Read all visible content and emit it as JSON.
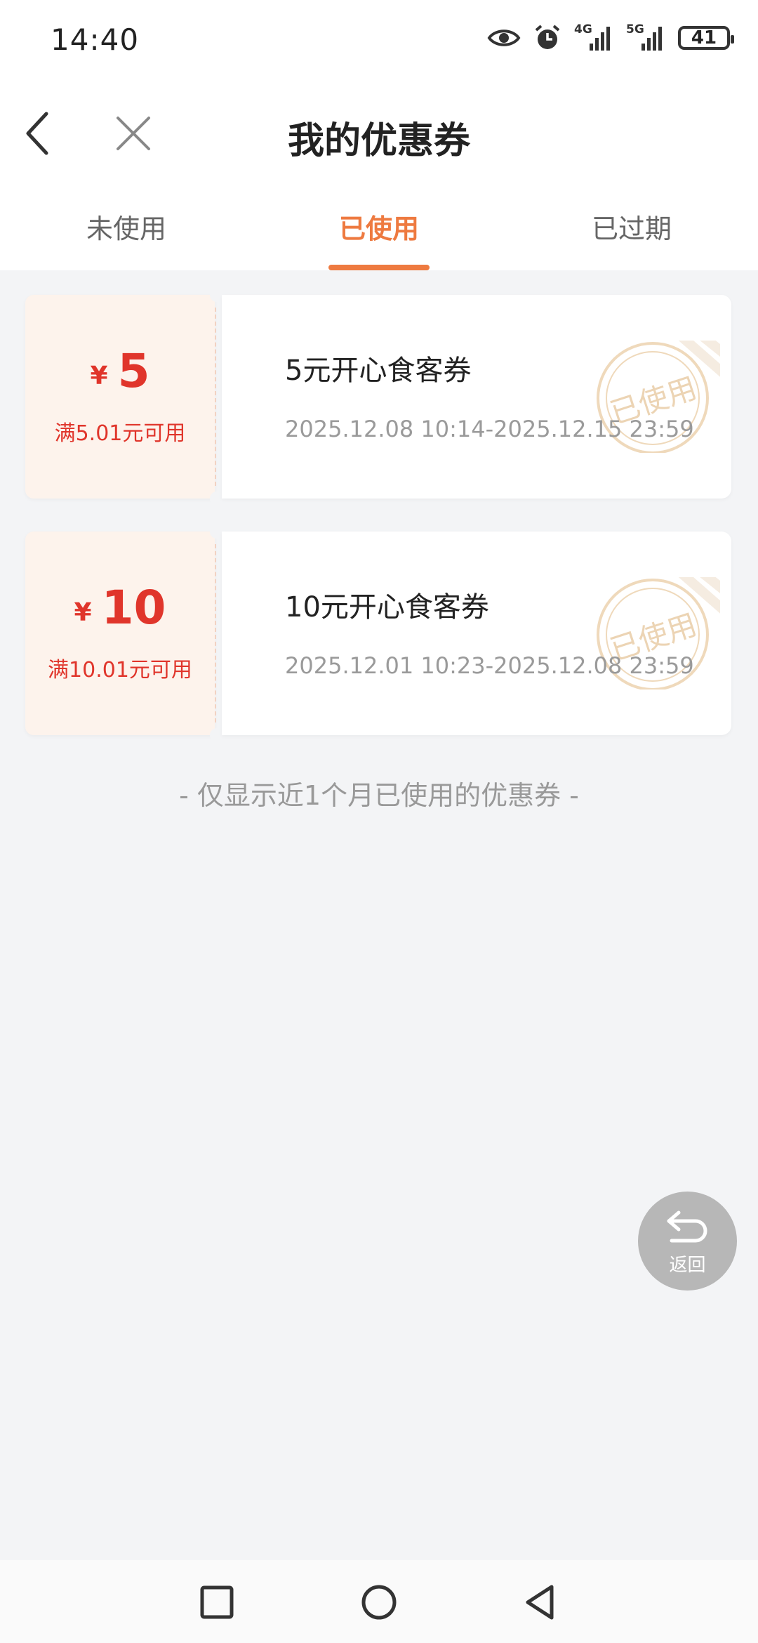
{
  "status_bar": {
    "time": "14:40",
    "signal_1": "4G",
    "signal_2": "5G",
    "battery": "41",
    "icons": [
      "eye-icon",
      "alarm-icon",
      "signal-icon",
      "signal-icon",
      "battery-icon"
    ]
  },
  "header": {
    "title": "我的优惠券",
    "back_icon": "chevron-left-icon",
    "close_icon": "close-icon"
  },
  "tabs": [
    {
      "label": "未使用",
      "active": false
    },
    {
      "label": "已使用",
      "active": true
    },
    {
      "label": "已过期",
      "active": false
    }
  ],
  "accent_color": "#ee7a40",
  "price_color": "#e0352b",
  "coupons": [
    {
      "currency": "¥",
      "amount": "5",
      "condition": "满5.01元可用",
      "name": "5元开心食客券",
      "period": "2025.12.08 10:14-2025.12.15 23:59",
      "stamp": "已使用"
    },
    {
      "currency": "¥",
      "amount": "10",
      "condition": "满10.01元可用",
      "name": "10元开心食客券",
      "period": "2025.12.01 10:23-2025.12.08 23:59",
      "stamp": "已使用"
    }
  ],
  "footer_note": "- 仅显示近1个月已使用的优惠券 -",
  "return_button": {
    "label": "返回",
    "icon": "return-arrow-icon"
  },
  "system_nav": [
    "square-icon",
    "circle-icon",
    "triangle-back-icon"
  ]
}
